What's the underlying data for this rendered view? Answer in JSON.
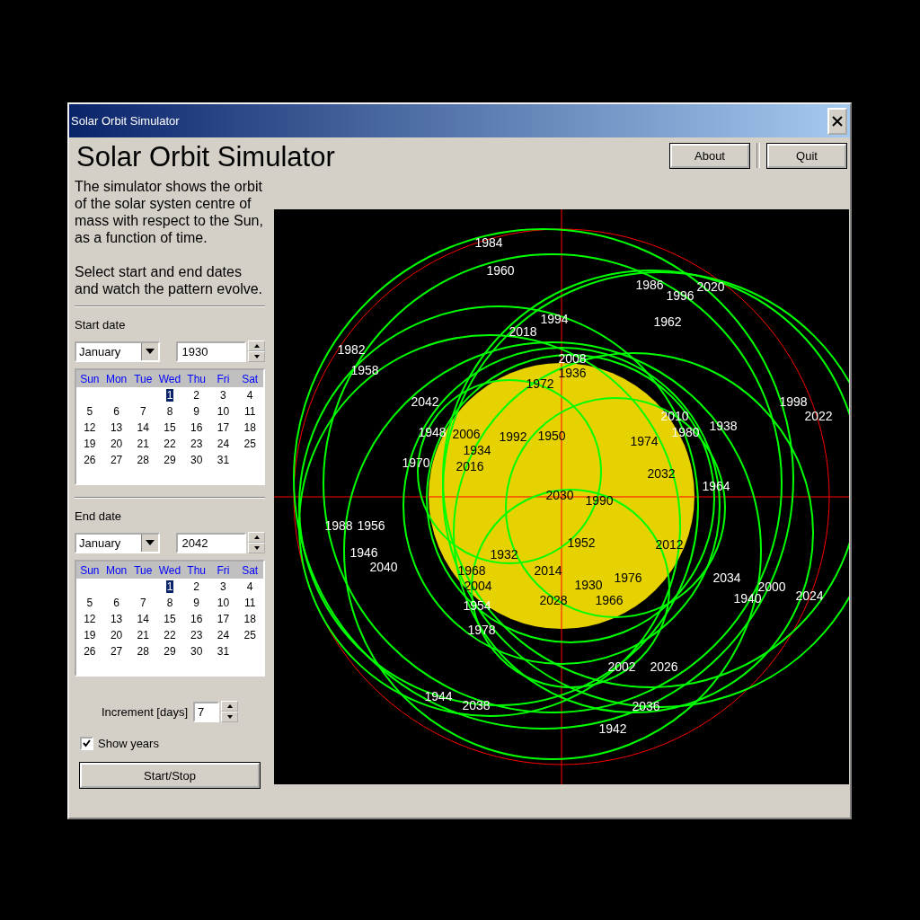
{
  "window": {
    "title": "Solar Orbit Simulator"
  },
  "heading": "Solar Orbit Simulator",
  "buttons": [
    {
      "label": "About"
    },
    {
      "label": "Quit"
    }
  ],
  "description": [
    "The simulator shows the orbit of the solar systen centre of mass with respect to the Sun, as a function of time.",
    "Select start and end dates and watch the pattern evolve."
  ],
  "date_pickers": [
    {
      "label": "Start date",
      "month": "January",
      "year": "1930",
      "weekdays": [
        "Sun",
        "Mon",
        "Tue",
        "Wed",
        "Thu",
        "Fri",
        "Sat"
      ],
      "weeks": [
        {
          "days": [
            {
              "label": "1",
              "selected": true
            },
            {
              "label": "2",
              "selected": false
            },
            {
              "label": "3",
              "selected": false
            },
            {
              "label": "4",
              "selected": false
            }
          ]
        },
        {
          "days": [
            {
              "label": "5",
              "selected": false
            },
            {
              "label": "6",
              "selected": false
            },
            {
              "label": "7",
              "selected": false
            },
            {
              "label": "8",
              "selected": false
            },
            {
              "label": "9",
              "selected": false
            },
            {
              "label": "10",
              "selected": false
            },
            {
              "label": "11",
              "selected": false
            }
          ]
        },
        {
          "days": [
            {
              "label": "12",
              "selected": false
            },
            {
              "label": "13",
              "selected": false
            },
            {
              "label": "14",
              "selected": false
            },
            {
              "label": "15",
              "selected": false
            },
            {
              "label": "16",
              "selected": false
            },
            {
              "label": "17",
              "selected": false
            },
            {
              "label": "18",
              "selected": false
            }
          ]
        },
        {
          "days": [
            {
              "label": "19",
              "selected": false
            },
            {
              "label": "20",
              "selected": false
            },
            {
              "label": "21",
              "selected": false
            },
            {
              "label": "22",
              "selected": false
            },
            {
              "label": "23",
              "selected": false
            },
            {
              "label": "24",
              "selected": false
            },
            {
              "label": "25",
              "selected": false
            }
          ]
        },
        {
          "days": [
            {
              "label": "26",
              "selected": false
            },
            {
              "label": "27",
              "selected": false
            },
            {
              "label": "28",
              "selected": false
            },
            {
              "label": "29",
              "selected": false
            },
            {
              "label": "30",
              "selected": false
            },
            {
              "label": "31",
              "selected": false
            }
          ]
        }
      ]
    },
    {
      "label": "End date",
      "month": "January",
      "year": "2042",
      "weekdays": [
        "Sun",
        "Mon",
        "Tue",
        "Wed",
        "Thu",
        "Fri",
        "Sat"
      ],
      "weeks": [
        {
          "days": [
            {
              "label": "1",
              "selected": true
            },
            {
              "label": "2",
              "selected": false
            },
            {
              "label": "3",
              "selected": false
            },
            {
              "label": "4",
              "selected": false
            }
          ]
        },
        {
          "days": [
            {
              "label": "5",
              "selected": false
            },
            {
              "label": "6",
              "selected": false
            },
            {
              "label": "7",
              "selected": false
            },
            {
              "label": "8",
              "selected": false
            },
            {
              "label": "9",
              "selected": false
            },
            {
              "label": "10",
              "selected": false
            },
            {
              "label": "11",
              "selected": false
            }
          ]
        },
        {
          "days": [
            {
              "label": "12",
              "selected": false
            },
            {
              "label": "13",
              "selected": false
            },
            {
              "label": "14",
              "selected": false
            },
            {
              "label": "15",
              "selected": false
            },
            {
              "label": "16",
              "selected": false
            },
            {
              "label": "17",
              "selected": false
            },
            {
              "label": "18",
              "selected": false
            }
          ]
        },
        {
          "days": [
            {
              "label": "19",
              "selected": false
            },
            {
              "label": "20",
              "selected": false
            },
            {
              "label": "21",
              "selected": false
            },
            {
              "label": "22",
              "selected": false
            },
            {
              "label": "23",
              "selected": false
            },
            {
              "label": "24",
              "selected": false
            },
            {
              "label": "25",
              "selected": false
            }
          ]
        },
        {
          "days": [
            {
              "label": "26",
              "selected": false
            },
            {
              "label": "27",
              "selected": false
            },
            {
              "label": "28",
              "selected": false
            },
            {
              "label": "29",
              "selected": false
            },
            {
              "label": "30",
              "selected": false
            },
            {
              "label": "31",
              "selected": false
            }
          ]
        }
      ]
    }
  ],
  "increment": {
    "label": "Increment [days]",
    "value": "7"
  },
  "show_years": {
    "label": "Show years",
    "checked": true
  },
  "start_stop": {
    "label": "Start/Stop"
  },
  "plot": {
    "year_labels": [
      "1930",
      "1932",
      "1934",
      "1936",
      "1938",
      "1940",
      "1942",
      "1944",
      "1946",
      "1948",
      "1950",
      "1952",
      "1954",
      "1956",
      "1958",
      "1960",
      "1962",
      "1964",
      "1966",
      "1968",
      "1970",
      "1972",
      "1974",
      "1976",
      "1978",
      "1980",
      "1982",
      "1984",
      "1986",
      "1988",
      "1990",
      "1992",
      "1994",
      "1996",
      "1998",
      "2000",
      "2002",
      "2004",
      "2006",
      "2008",
      "2010",
      "2012",
      "2014",
      "2016",
      "2018",
      "2020",
      "2022",
      "2024",
      "2026",
      "2028",
      "2030",
      "2032",
      "2034",
      "2036",
      "2038",
      "2040",
      "2042"
    ]
  }
}
